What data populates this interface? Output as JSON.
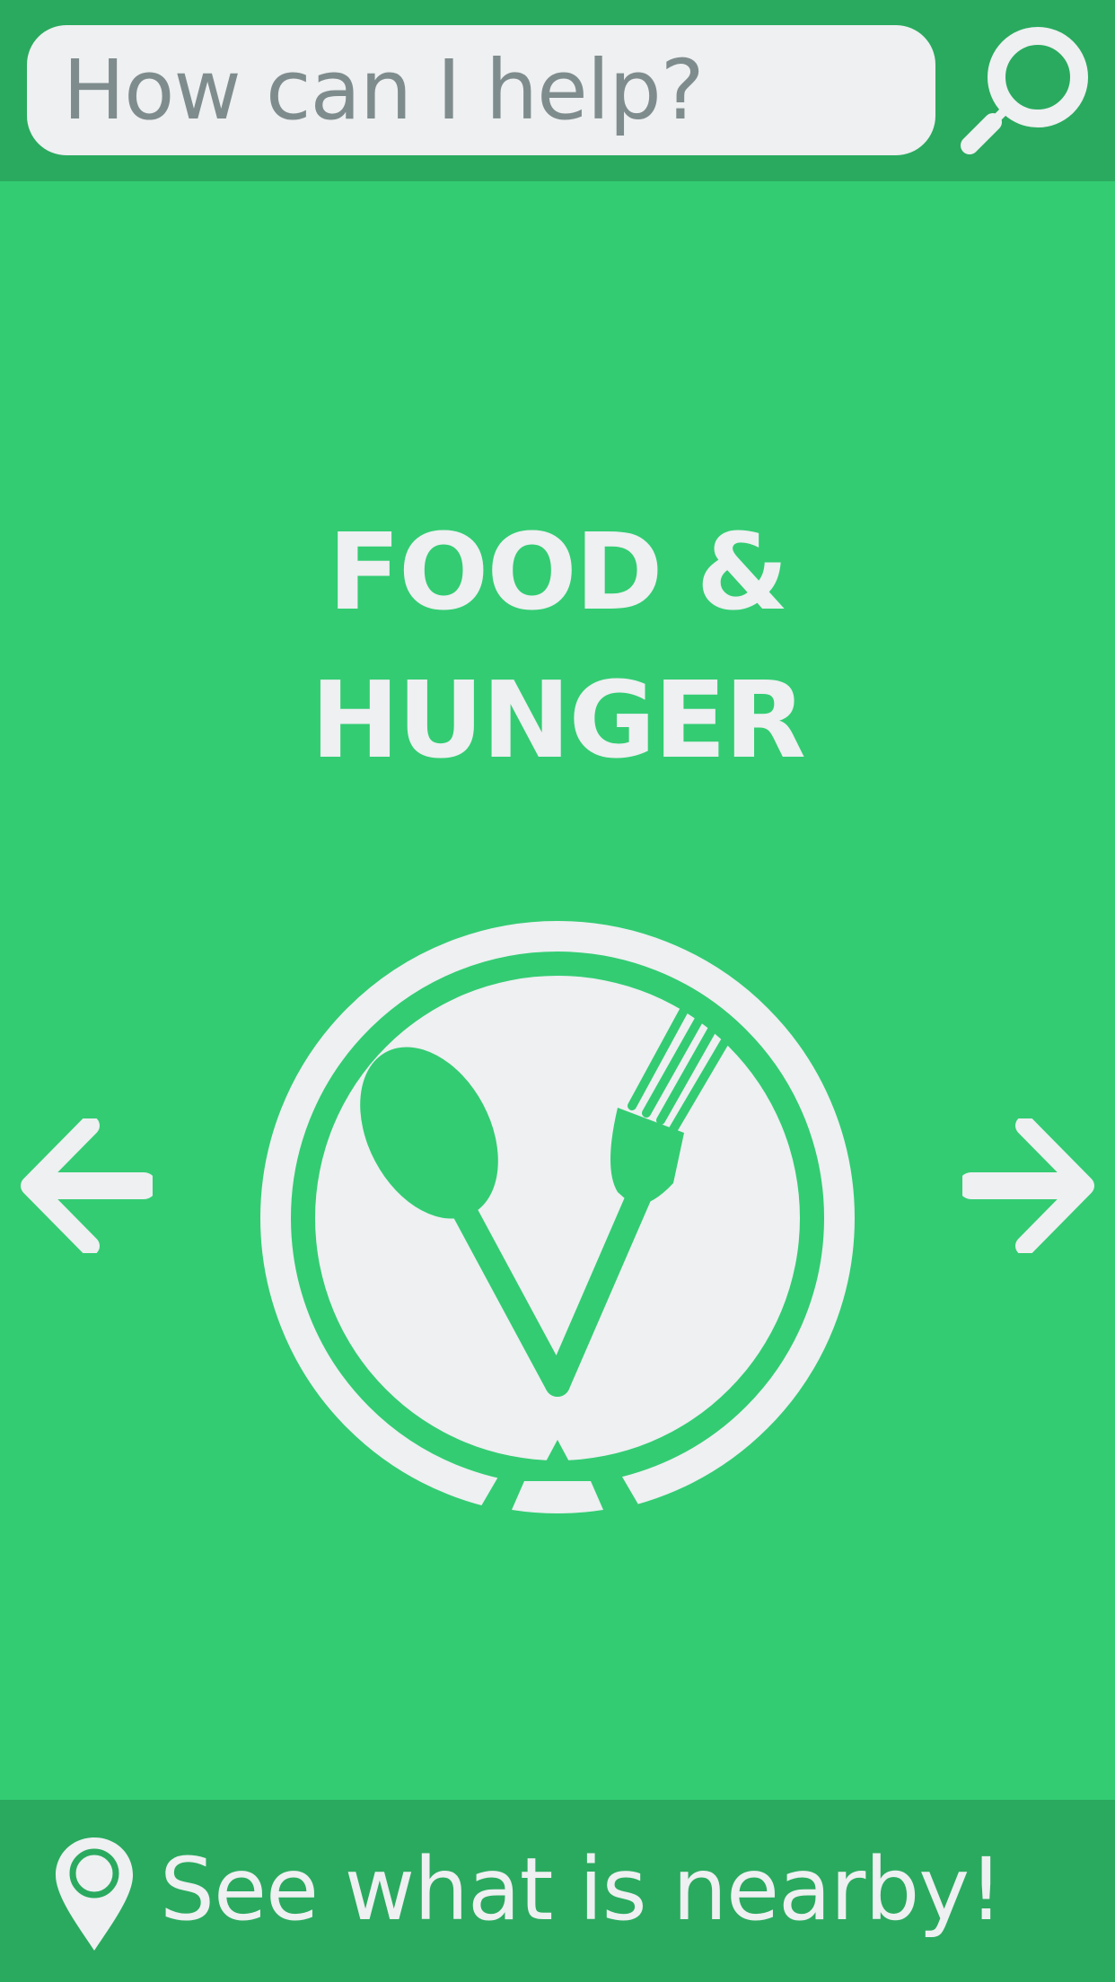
{
  "search": {
    "placeholder": "How can I help?",
    "button_icon": "search-icon"
  },
  "category": {
    "title_line1": "FOOD &",
    "title_line2": "HUNGER",
    "icon": "plate-spoon-fork-icon"
  },
  "navigation": {
    "previous_icon": "arrow-left-icon",
    "next_icon": "arrow-right-icon"
  },
  "footer": {
    "label": "See what is nearby!",
    "icon": "map-pin-icon"
  },
  "colors": {
    "background": "#33cc73",
    "bar": "#2aaa5f",
    "foreground": "#eef0f1",
    "placeholder_text": "#7f8c8d"
  }
}
